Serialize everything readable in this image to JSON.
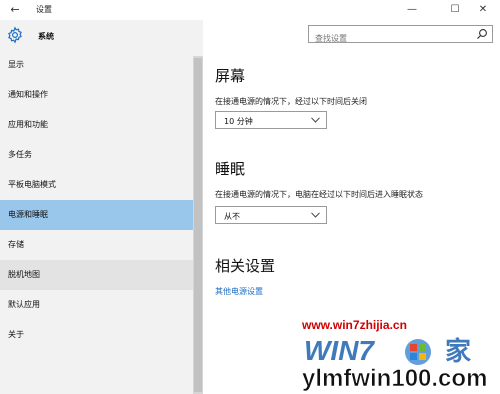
{
  "titlebar": {
    "title": "设置",
    "back": "←",
    "minimize": "—",
    "maximize": "☐",
    "close": "✕"
  },
  "sidebar": {
    "header_title": "系统",
    "header_icon": "gear-icon",
    "items": [
      {
        "label": "显示"
      },
      {
        "label": "通知和操作"
      },
      {
        "label": "应用和功能"
      },
      {
        "label": "多任务"
      },
      {
        "label": "平板电脑模式"
      },
      {
        "label": "电源和睡眠",
        "selected": true
      },
      {
        "label": "存储"
      },
      {
        "label": "脱机地图",
        "hover": true
      },
      {
        "label": "默认应用"
      },
      {
        "label": "关于"
      }
    ]
  },
  "search": {
    "placeholder": "查找设置",
    "icon": "search-icon"
  },
  "main": {
    "screen": {
      "heading": "屏幕",
      "description": "在接通电源的情况下，经过以下时间后关闭",
      "value": "10 分钟"
    },
    "sleep": {
      "heading": "睡眠",
      "description": "在接通电源的情况下，电脑在经过以下时间后进入睡眠状态",
      "value": "从不"
    },
    "related": {
      "heading": "相关设置",
      "link": "其他电源设置"
    }
  },
  "watermark": {
    "url": "www.win7zhijia.cn",
    "logo_text": "ylmfwin100.com"
  },
  "colors": {
    "sidebar_bg": "#f2f2f2",
    "selected_bg": "#99c6eb",
    "accent": "#1d6ec4",
    "watermark_red": "#d10000"
  }
}
